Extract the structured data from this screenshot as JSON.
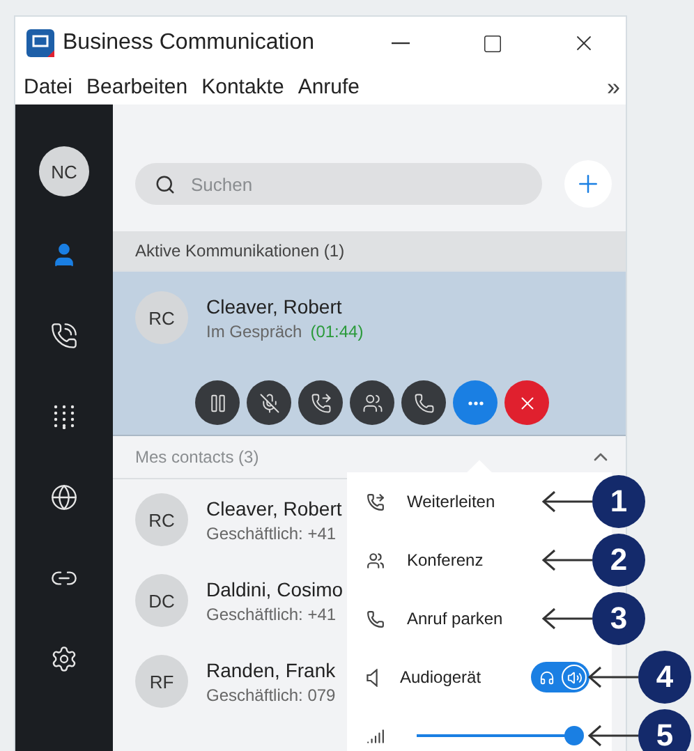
{
  "window": {
    "title": "Business Communication"
  },
  "menu": {
    "items": [
      "Datei",
      "Bearbeiten",
      "Kontakte",
      "Anrufe"
    ],
    "overflow": "»"
  },
  "sidebar": {
    "avatar": "NC",
    "items": [
      {
        "kind": "contacts",
        "selected": true
      },
      {
        "kind": "history",
        "selected": false
      },
      {
        "kind": "dialpad",
        "selected": false
      },
      {
        "kind": "globe",
        "selected": false
      },
      {
        "kind": "link",
        "selected": false
      },
      {
        "kind": "settings",
        "selected": false
      }
    ]
  },
  "search": {
    "placeholder": "Suchen"
  },
  "active_section": {
    "title": "Aktive Kommunikationen (1)"
  },
  "active_call": {
    "initials": "RC",
    "name": "Cleaver, Robert",
    "status": "Im Gespräch",
    "duration": "(01:44)",
    "buttons": [
      {
        "kind": "hold",
        "selected": false
      },
      {
        "kind": "mute",
        "selected": false
      },
      {
        "kind": "transfer",
        "selected": false
      },
      {
        "kind": "conference",
        "selected": false
      },
      {
        "kind": "park",
        "selected": false
      },
      {
        "kind": "more",
        "selected": true
      },
      {
        "kind": "hangup",
        "selected": false
      }
    ]
  },
  "contacts_section": {
    "title": "Mes contacts (3)",
    "expanded": true
  },
  "contacts": [
    {
      "initials": "RC",
      "name": "Cleaver, Robert",
      "detail": "Geschäftlich: +41"
    },
    {
      "initials": "DC",
      "name": "Daldini, Cosimo",
      "detail": "Geschäftlich: +41"
    },
    {
      "initials": "RF",
      "name": "Randen, Frank",
      "detail": "Geschäftlich: 079"
    }
  ],
  "popup_menu": [
    {
      "kind": "action",
      "label": "Weiterleiten",
      "callout": "1"
    },
    {
      "kind": "action",
      "label": "Konferenz",
      "callout": "2"
    },
    {
      "kind": "action",
      "label": "Anruf parken",
      "callout": "3"
    },
    {
      "kind": "audio",
      "label": "Audiogerät",
      "options": [
        {
          "kind": "headset",
          "selected": false
        },
        {
          "kind": "speaker",
          "selected": true
        }
      ],
      "callout": "4"
    },
    {
      "kind": "volume",
      "level": 0.97,
      "callout": "5"
    }
  ]
}
